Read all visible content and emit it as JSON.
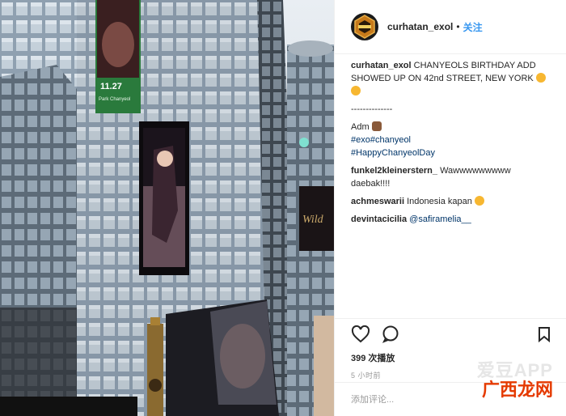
{
  "post": {
    "username": "curhatan_exol",
    "follow_label": "关注",
    "dot": "•",
    "caption_lines": [
      "CHANYEOLS BIRTHDAY ADD",
      "SHOWED UP ON 42nd STREET, NEW YORK"
    ],
    "separator": "--------------",
    "adm": "Adm",
    "hashtags_line1": "#exo#chanyeol",
    "hashtags_line2": "#HappyChanyeolDay",
    "comments": [
      {
        "user": "funkel2kleinerstern_",
        "text": "Wawwwwwwwww",
        "text2": "daebak!!!!"
      },
      {
        "user": "achmeswarii",
        "text": "Indonesia kapan"
      },
      {
        "user": "devintacicilia",
        "text": "@safiramelia__"
      }
    ],
    "views": "399 次播放",
    "time": "5 小时前",
    "add_comment_placeholder": "添加评论..."
  },
  "billboard": {
    "date": "11.27",
    "name": "Park Chanyeol"
  },
  "watermark": {
    "line1": "爱豆APP",
    "line2": "广西龙网"
  },
  "colors": {
    "follow": "#3897f0",
    "hashtag": "#003569",
    "text": "#262626",
    "muted": "#999999"
  },
  "icons": [
    "heart-icon",
    "comment-icon",
    "bookmark-icon"
  ]
}
